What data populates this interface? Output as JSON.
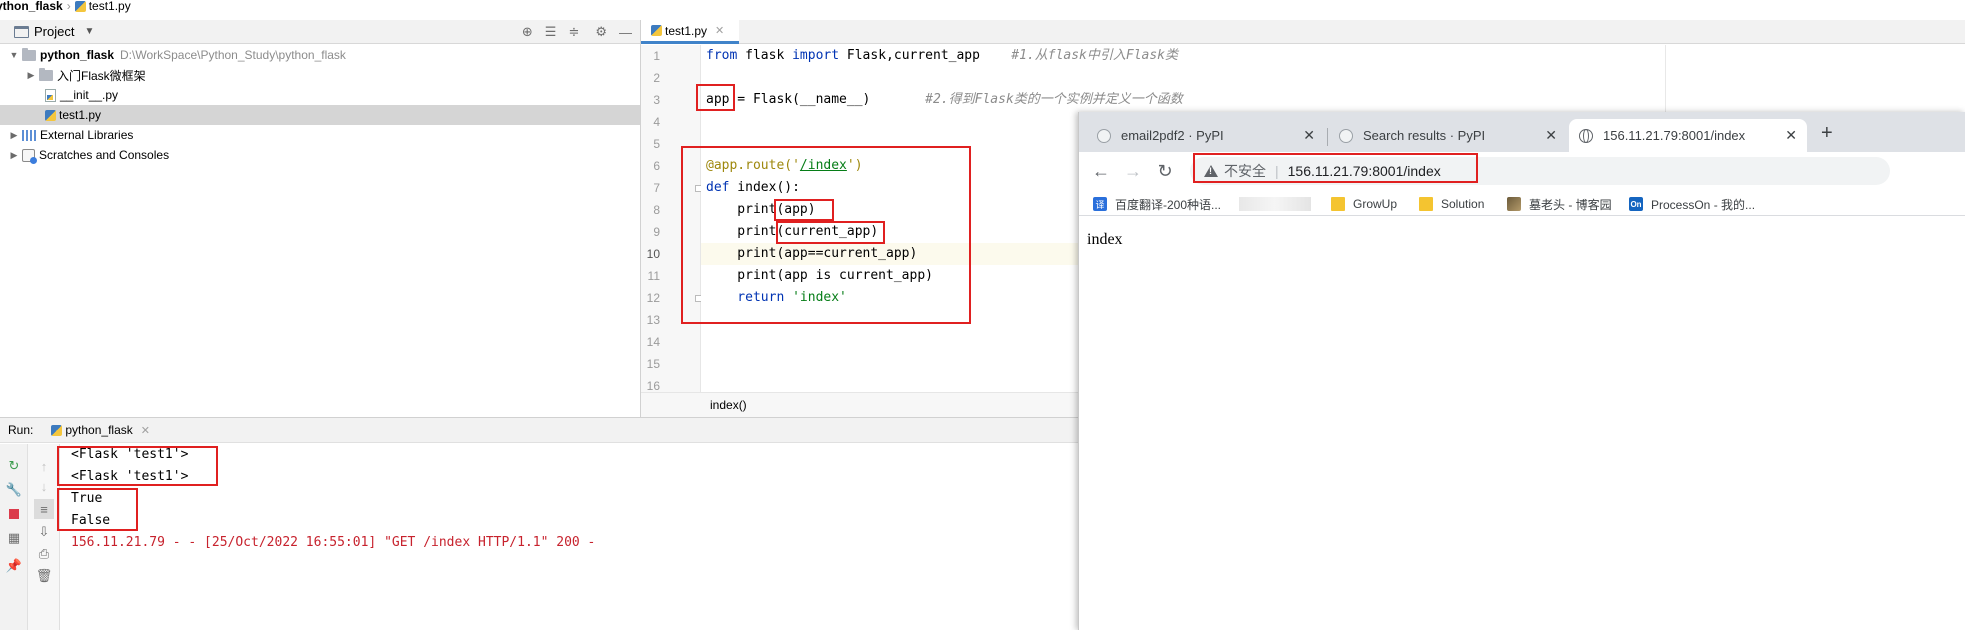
{
  "breadcrumb": {
    "root": "ython_flask",
    "file": "test1.py"
  },
  "project_panel": {
    "title": "Project",
    "tree": [
      {
        "label": "python_flask",
        "path": "D:\\WorkSpace\\Python_Study\\python_flask"
      },
      {
        "label": "入门Flask微框架"
      },
      {
        "label": "__init__.py"
      },
      {
        "label": "test1.py"
      },
      {
        "label": "External Libraries"
      },
      {
        "label": "Scratches and Consoles"
      }
    ]
  },
  "editor": {
    "tab_label": "test1.py",
    "line_numbers": [
      "1",
      "2",
      "3",
      "4",
      "5",
      "6",
      "7",
      "8",
      "9",
      "10",
      "11",
      "12",
      "13",
      "14",
      "15",
      "16"
    ],
    "current_line": "10",
    "code": {
      "l1_from": "from",
      "l1_mod": " flask ",
      "l1_import": "import",
      "l1_names": " Flask,current_app    ",
      "l1_comment": "#1.从flask中引入Flask类",
      "l3_app": "app",
      "l3_rest": " = Flask(__name__)       ",
      "l3_comment": "#2.得到Flask类的一个实例并定义一个函数",
      "l6_deco_a": "@app.route('",
      "l6_url": "/index",
      "l6_deco_b": "')",
      "l7_def": "def",
      "l7_rest": " index():",
      "l8": "    print(app)",
      "l9": "    print(current_app)",
      "l10": "    print(app==current_app)",
      "l11": "    print(app is current_app)",
      "l12_return": "    return ",
      "l12_str": "'index'"
    },
    "breadcrumb": "index()"
  },
  "run_panel": {
    "label": "Run:",
    "tab_label": "python_flask",
    "output": [
      "<Flask 'test1'>",
      "<Flask 'test1'>",
      "True",
      "False",
      "156.11.21.79 - - [25/Oct/2022 16:55:01] \"GET /index HTTP/1.1\" 200 -"
    ]
  },
  "browser": {
    "tabs": [
      {
        "title": "email2pdf2 · PyPI"
      },
      {
        "title": "Search results · PyPI"
      },
      {
        "title": "156.11.21.79:8001/index"
      }
    ],
    "security_label": "不安全",
    "url": "156.11.21.79:8001/index",
    "bookmarks": [
      {
        "label": "百度翻译-200种语..."
      },
      {
        "label": "GrowUp"
      },
      {
        "label": "Solution"
      },
      {
        "label": "墓老头 - 博客园"
      },
      {
        "label": "ProcessOn - 我的..."
      }
    ],
    "page_text": "index"
  },
  "colors": {
    "annotation_red": "#e02020",
    "keyword_blue": "#0033b3",
    "string_green": "#067d17",
    "error_red": "#c7222d",
    "selection_gray": "#d5d5d5"
  }
}
